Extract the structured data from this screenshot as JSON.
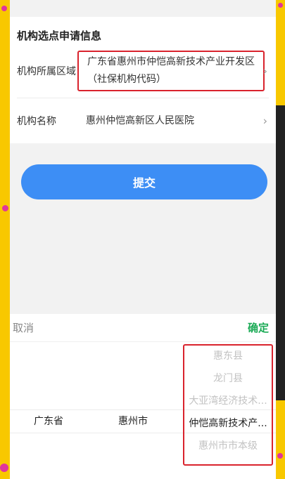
{
  "form": {
    "section_title": "机构选点申请信息",
    "area_label": "机构所属区域",
    "area_value": "广东省惠州市仲恺高新技术产业开发区（社保机构代码）",
    "name_label": "机构名称",
    "name_value": "惠州仲恺高新区人民医院"
  },
  "submit_label": "提交",
  "picker": {
    "cancel_label": "取消",
    "confirm_label": "确定",
    "province_selected": "广东省",
    "city_selected": "惠州市",
    "district_options": [
      "惠东县",
      "龙门县",
      "大亚湾经济技术...",
      "仲恺高新技术产...",
      "惠州市市本级"
    ]
  },
  "icons": {
    "chevron": "chevron-right-icon"
  }
}
